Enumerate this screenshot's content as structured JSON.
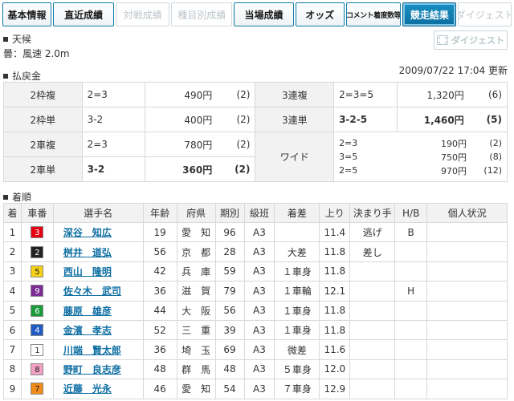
{
  "tabs": [
    {
      "label": "基本情報",
      "state": "normal"
    },
    {
      "label": "直近成績",
      "state": "normal"
    },
    {
      "label": "対戦成績",
      "state": "disabled"
    },
    {
      "label": "種目別成績",
      "state": "disabled"
    },
    {
      "label": "当場成績",
      "state": "normal"
    },
    {
      "label": "オッズ",
      "state": "normal"
    },
    {
      "label": "コメント着度数等",
      "state": "normal"
    },
    {
      "label": "競走結果",
      "state": "active"
    },
    {
      "label": "ダイジェスト",
      "state": "disabled"
    }
  ],
  "weather": {
    "heading": "天候",
    "text": "曇：風速 2.0m"
  },
  "digest_button": {
    "label": "ダイジェスト"
  },
  "updated": "2009/07/22 17:04 更新",
  "payout": {
    "heading": "払戻金",
    "rows": [
      [
        {
          "label": "2枠複",
          "comb": "2=3",
          "amount": "490円",
          "pop": "(2)",
          "bold": false
        },
        {
          "label": "3連複",
          "comb": "2=3=5",
          "amount": "1,320円",
          "pop": "(6)",
          "bold": false
        }
      ],
      [
        {
          "label": "2枠単",
          "comb": "3-2",
          "amount": "400円",
          "pop": "(2)",
          "bold": false
        },
        {
          "label": "3連単",
          "comb": "3-2-5",
          "amount": "1,460円",
          "pop": "(5)",
          "bold": true
        }
      ],
      [
        {
          "label": "2車複",
          "comb": "2=3",
          "amount": "780円",
          "pop": "(2)",
          "bold": false
        }
      ],
      [
        {
          "label": "2車単",
          "comb": "3-2",
          "amount": "360円",
          "pop": "(2)",
          "bold": true
        }
      ]
    ],
    "wide": {
      "label": "ワイド",
      "lines": [
        {
          "comb": "2=3",
          "amount": "190円",
          "pop": "(2)"
        },
        {
          "comb": "3=5",
          "amount": "750円",
          "pop": "(8)"
        },
        {
          "comb": "2=5",
          "amount": "970円",
          "pop": "(12)"
        }
      ]
    }
  },
  "results": {
    "heading": "着順",
    "columns": [
      "着",
      "車番",
      "選手名",
      "年齢",
      "府県",
      "期別",
      "級班",
      "着差",
      "上り",
      "決まり手",
      "H/B",
      "個人状況"
    ],
    "rows": [
      {
        "rank": "1",
        "car": "3",
        "car_bg": "#e60012",
        "car_fg": "#ffffff",
        "name": "深谷　知広",
        "age": "19",
        "pref": "愛　知",
        "term": "96",
        "cls": "A3",
        "margin": "",
        "agari": "11.4",
        "kimarite": "逃げ",
        "hb": "B",
        "status": ""
      },
      {
        "rank": "2",
        "car": "2",
        "car_bg": "#222222",
        "car_fg": "#ffffff",
        "name": "桝井　道弘",
        "age": "56",
        "pref": "京　都",
        "term": "28",
        "cls": "A3",
        "margin": "大差",
        "agari": "11.8",
        "kimarite": "差し",
        "hb": "",
        "status": ""
      },
      {
        "rank": "3",
        "car": "5",
        "car_bg": "#f7d117",
        "car_fg": "#222222",
        "name": "西山　隆明",
        "age": "42",
        "pref": "兵　庫",
        "term": "59",
        "cls": "A3",
        "margin": "１車身",
        "agari": "11.8",
        "kimarite": "",
        "hb": "",
        "status": ""
      },
      {
        "rank": "4",
        "car": "9",
        "car_bg": "#7b2d94",
        "car_fg": "#ffffff",
        "name": "佐々木　武司",
        "age": "36",
        "pref": "滋　賀",
        "term": "79",
        "cls": "A3",
        "margin": "１車輪",
        "agari": "12.1",
        "kimarite": "",
        "hb": "H",
        "status": ""
      },
      {
        "rank": "5",
        "car": "6",
        "car_bg": "#1a9a3b",
        "car_fg": "#ffffff",
        "name": "藤原　雄彦",
        "age": "44",
        "pref": "大　阪",
        "term": "56",
        "cls": "A3",
        "margin": "１車身",
        "agari": "11.8",
        "kimarite": "",
        "hb": "",
        "status": ""
      },
      {
        "rank": "6",
        "car": "4",
        "car_bg": "#1f5bc4",
        "car_fg": "#ffffff",
        "name": "金濱　孝志",
        "age": "52",
        "pref": "三　重",
        "term": "39",
        "cls": "A3",
        "margin": "１車身",
        "agari": "11.8",
        "kimarite": "",
        "hb": "",
        "status": ""
      },
      {
        "rank": "7",
        "car": "1",
        "car_bg": "#ffffff",
        "car_fg": "#222222",
        "name": "川端　賢太郎",
        "age": "36",
        "pref": "埼　玉",
        "term": "69",
        "cls": "A3",
        "margin": "微差",
        "agari": "11.6",
        "kimarite": "",
        "hb": "",
        "status": ""
      },
      {
        "rank": "8",
        "car": "8",
        "car_bg": "#f2a0c4",
        "car_fg": "#222222",
        "name": "野町　良志彦",
        "age": "48",
        "pref": "群　馬",
        "term": "48",
        "cls": "A3",
        "margin": "５車身",
        "agari": "12.0",
        "kimarite": "",
        "hb": "",
        "status": ""
      },
      {
        "rank": "9",
        "car": "7",
        "car_bg": "#f08c1a",
        "car_fg": "#222222",
        "name": "近藤　光永",
        "age": "46",
        "pref": "愛　知",
        "term": "54",
        "cls": "A3",
        "margin": "７車身",
        "agari": "12.9",
        "kimarite": "",
        "hb": "",
        "status": ""
      }
    ]
  }
}
